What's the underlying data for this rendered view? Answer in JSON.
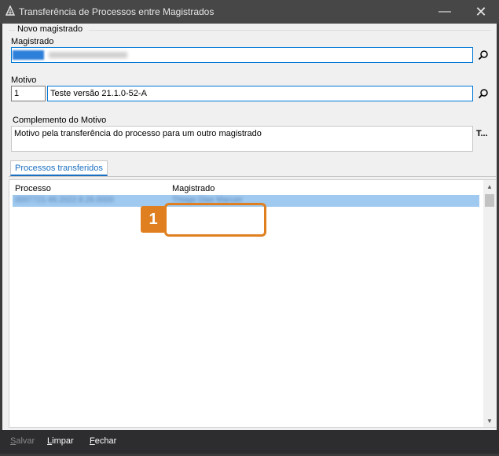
{
  "window": {
    "title": "Transferência de Processos entre Magistrados",
    "minimize_glyph": "—",
    "close_glyph": "✕"
  },
  "novo_magistrado": {
    "group_label": "Novo magistrado",
    "magistrado_label": "Magistrado",
    "magistrado_value": "",
    "motivo_label": "Motivo",
    "motivo_code": "1",
    "motivo_description": "Teste versão 21.1.0-52-A",
    "complemento_label": "Complemento do Motivo",
    "complemento_value": "Motivo pela transferência do processo para um outro magistrado",
    "complemento_button": "T..."
  },
  "tabs": [
    {
      "label": "Processos transferidos"
    }
  ],
  "grid": {
    "columns": [
      "Processo",
      "Magistrado"
    ],
    "rows": [
      {
        "processo": "0007721-46.2022.8.26.0000",
        "magistrado": "Thiago Dias Macuer"
      }
    ]
  },
  "callout": {
    "number": "1",
    "color": "#e07f1f"
  },
  "footer": {
    "salvar": {
      "first": "S",
      "rest": "alvar"
    },
    "limpar": {
      "first": "L",
      "rest": "impar"
    },
    "fechar": {
      "first": "F",
      "rest": "echar"
    }
  },
  "icons": {
    "app": "scales-icon",
    "lookup": "search-icon"
  },
  "colors": {
    "titlebar": "#474747",
    "selection": "#9fc9ee",
    "tab_accent": "#1a6fc1",
    "active_border": "#0078d7"
  }
}
